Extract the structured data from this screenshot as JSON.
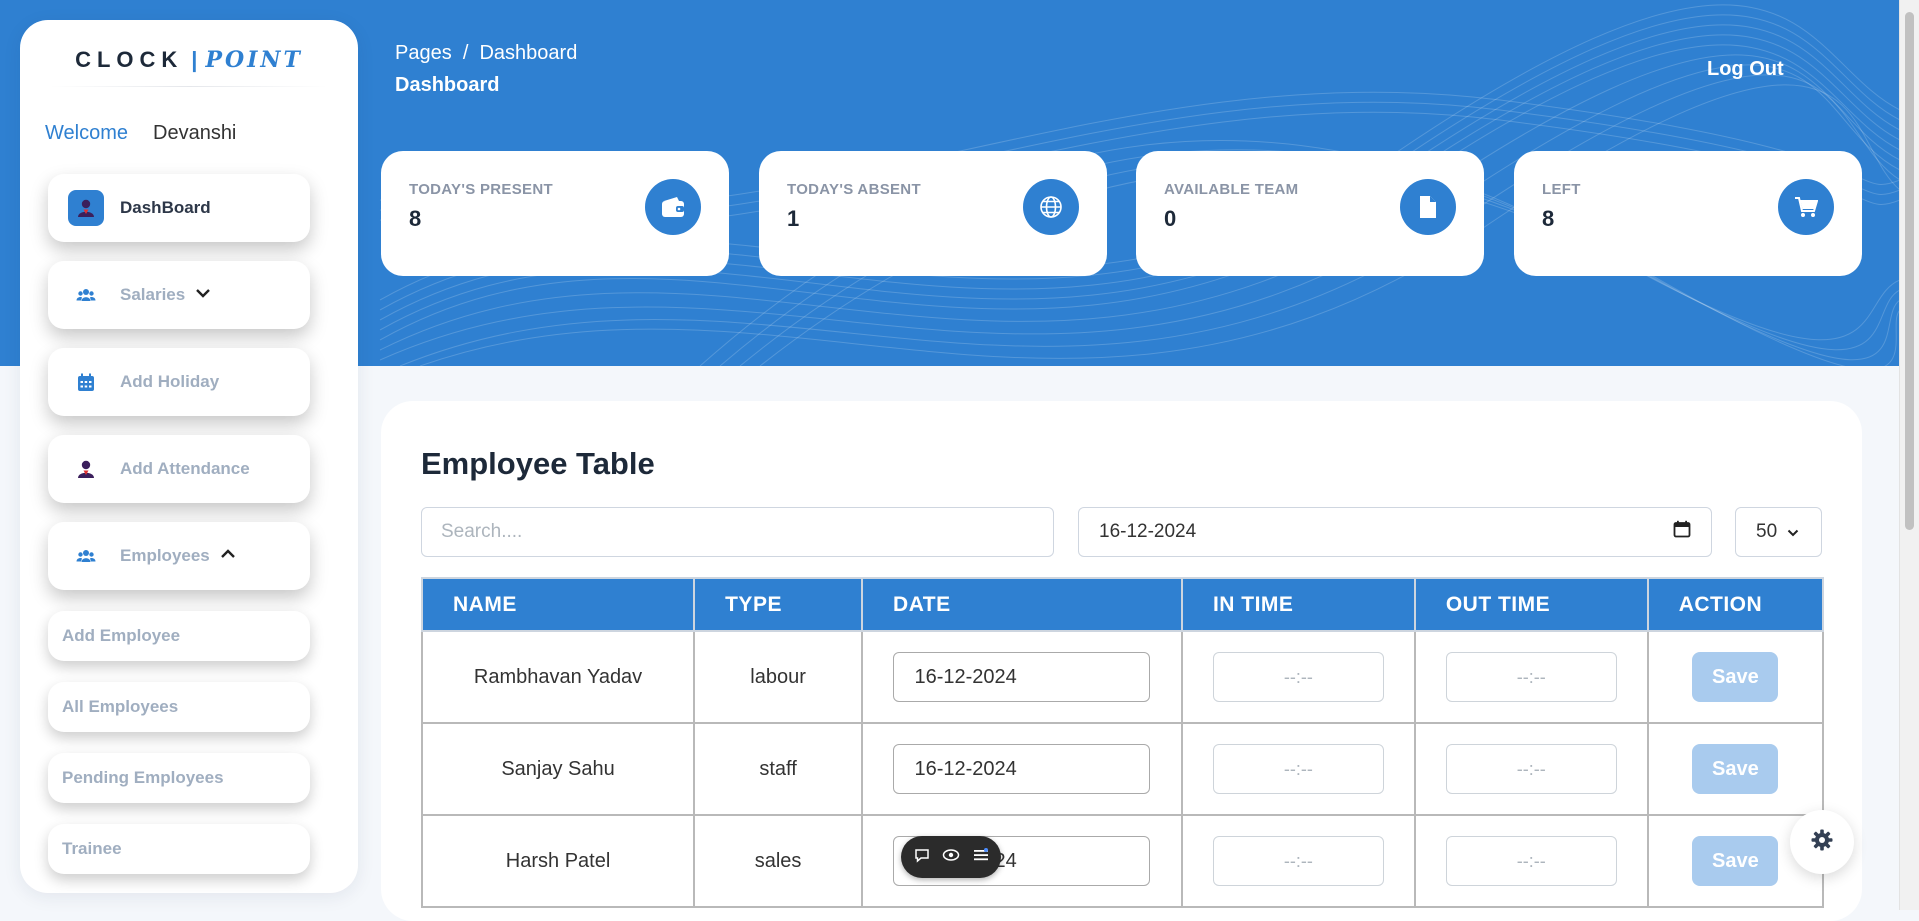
{
  "brand": {
    "word1": "CLOCK",
    "separator": "|",
    "word2": "POINT"
  },
  "welcome": {
    "label": "Welcome",
    "user": "Devanshi"
  },
  "sidebar": {
    "items": [
      {
        "label": "DashBoard",
        "icon": "user-icon",
        "active": true
      },
      {
        "label": "Salaries",
        "icon": "users-icon",
        "chevron": "chevron-down-icon"
      },
      {
        "label": "Add Holiday",
        "icon": "calendar-icon"
      },
      {
        "label": "Add Attendance",
        "icon": "user-icon"
      },
      {
        "label": "Employees",
        "icon": "users-icon",
        "chevron": "chevron-up-icon",
        "expanded": true
      }
    ],
    "subitems": [
      {
        "label": "Add Employee"
      },
      {
        "label": "All Employees"
      },
      {
        "label": "Pending Employees"
      },
      {
        "label": "Trainee"
      }
    ]
  },
  "header": {
    "breadcrumb": "Pages  /  Dashboard",
    "title": "Dashboard",
    "logout": "Log Out"
  },
  "stats": [
    {
      "label": "TODAY'S PRESENT",
      "value": "8",
      "icon": "wallet-icon"
    },
    {
      "label": "TODAY'S ABSENT",
      "value": "1",
      "icon": "globe-icon"
    },
    {
      "label": "AVAILABLE TEAM",
      "value": "0",
      "icon": "document-icon"
    },
    {
      "label": "LEFT",
      "value": "8",
      "icon": "cart-icon"
    }
  ],
  "table": {
    "title": "Employee Table",
    "search_placeholder": "Search....",
    "date_filter": "16-12-2024",
    "per_page": "50",
    "columns": [
      "NAME",
      "TYPE",
      "DATE",
      "IN TIME",
      "OUT TIME",
      "ACTION"
    ],
    "rows": [
      {
        "name": "Rambhavan Yadav",
        "type": "labour",
        "date": "16-12-2024",
        "in_time": "--:--",
        "out_time": "--:--",
        "action": "Save"
      },
      {
        "name": "Sanjay Sahu",
        "type": "staff",
        "date": "16-12-2024",
        "in_time": "--:--",
        "out_time": "--:--",
        "action": "Save"
      },
      {
        "name": "Harsh Patel",
        "type": "sales",
        "date": "16-12-2024",
        "in_time": "--:--",
        "out_time": "--:--",
        "action": "Save"
      }
    ]
  },
  "colors": {
    "primary": "#2f80d1",
    "save_disabled": "#a9cbee",
    "background": "#f4f7fb"
  }
}
